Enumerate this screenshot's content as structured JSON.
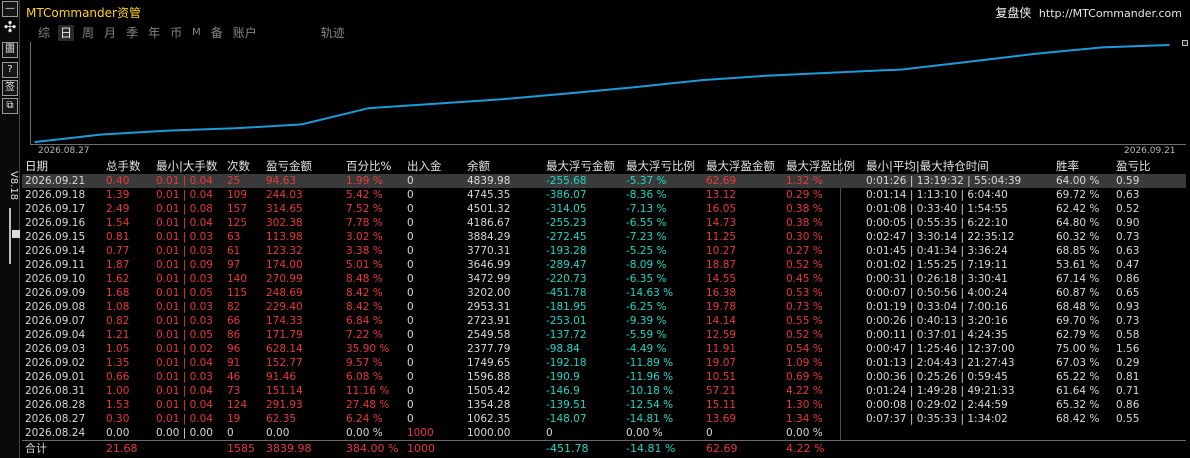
{
  "app": {
    "title": "MTCommander资管",
    "brand_name": "复盘侠",
    "brand_url": "http://MTCommander.com",
    "version": "V8.18"
  },
  "toolbar": {
    "icons": [
      "minus-icon",
      "move-icon",
      "doc-icon",
      "help-icon",
      "checkin-icon",
      "restore-icon"
    ],
    "labels": [
      "—",
      "✣",
      "圕",
      "?",
      "签",
      "⧉"
    ]
  },
  "tabs": [
    {
      "label": "综",
      "active": false
    },
    {
      "label": "日",
      "active": true
    },
    {
      "label": "周",
      "active": false
    },
    {
      "label": "月",
      "active": false
    },
    {
      "label": "季",
      "active": false
    },
    {
      "label": "年",
      "active": false
    },
    {
      "label": "币",
      "active": false
    },
    {
      "label": "M",
      "active": false
    },
    {
      "label": "备",
      "active": false
    },
    {
      "label": "账户",
      "active": false
    },
    {
      "label": "轨迹",
      "active": false
    }
  ],
  "chart_data": {
    "type": "line",
    "x_start": "2026.08.27",
    "x_end": "2026.09.21",
    "line_color": "#1c9bd8",
    "values": [
      1062.35,
      1354.28,
      1505.42,
      1596.88,
      1749.65,
      2377.79,
      2549.58,
      2723.91,
      2953.31,
      3202.0,
      3472.99,
      3646.99,
      3770.31,
      3884.29,
      4186.67,
      4501.32,
      4745.35,
      4839.98
    ]
  },
  "table": {
    "headers": [
      "日期",
      "总手数",
      "最小|大手数",
      "次数",
      "盈亏金额",
      "百分比%",
      "出入金",
      "余额",
      "最大浮亏金额",
      "最大浮亏比例",
      "最大浮盈金额",
      "最大浮盈比例",
      "最小|平均|最大持仓时间",
      "胜率",
      "盈亏比"
    ],
    "rows": [
      [
        "2026.09.21",
        "0.40",
        "0.01 | 0.04",
        "25",
        "94.63",
        "1.99 %",
        "0",
        "4839.98",
        "-255.68",
        "-5.37 %",
        "62.69",
        "1.32 %",
        "0:01:26 | 13:19:32 | 55:04:39",
        "64.00 %",
        "0.59"
      ],
      [
        "2026.09.18",
        "1.39",
        "0.01 | 0.04",
        "109",
        "244.03",
        "5.42 %",
        "0",
        "4745.35",
        "-386.07",
        "-8.36 %",
        "13.12",
        "0.29 %",
        "0:01:14 | 1:13:10 | 6:04:40",
        "69.72 %",
        "0.63"
      ],
      [
        "2026.09.17",
        "2.49",
        "0.01 | 0.08",
        "157",
        "314.65",
        "7.52 %",
        "0",
        "4501.32",
        "-314.05",
        "-7.13 %",
        "16.05",
        "0.38 %",
        "0:01:08 | 0:33:40 | 1:54:55",
        "62.42 %",
        "0.52"
      ],
      [
        "2026.09.16",
        "1.54",
        "0.01 | 0.04",
        "125",
        "302.38",
        "7.78 %",
        "0",
        "4186.67",
        "-255.23",
        "-6.55 %",
        "14.73",
        "0.38 %",
        "0:00:05 | 0:55:35 | 6:22:10",
        "64.80 %",
        "0.90"
      ],
      [
        "2026.09.15",
        "0.81",
        "0.01 | 0.03",
        "63",
        "113.98",
        "3.02 %",
        "0",
        "3884.29",
        "-272.45",
        "-7.23 %",
        "11.25",
        "0.30 %",
        "0:02:47 | 3:30:14 | 22:35:12",
        "60.32 %",
        "0.73"
      ],
      [
        "2026.09.14",
        "0.77",
        "0.01 | 0.03",
        "61",
        "123.32",
        "3.38 %",
        "0",
        "3770.31",
        "-193.28",
        "-5.25 %",
        "10.27",
        "0.27 %",
        "0:01:45 | 0:41:34 | 3:36:24",
        "68.85 %",
        "0.63"
      ],
      [
        "2026.09.11",
        "1.87",
        "0.01 | 0.09",
        "97",
        "174.00",
        "5.01 %",
        "0",
        "3646.99",
        "-289.47",
        "-8.09 %",
        "18.87",
        "0.52 %",
        "0:01:02 | 1:55:25 | 7:19:11",
        "53.61 %",
        "0.47"
      ],
      [
        "2026.09.10",
        "1.62",
        "0.01 | 0.03",
        "140",
        "270.99",
        "8.48 %",
        "0",
        "3472.99",
        "-220.73",
        "-6.35 %",
        "14.55",
        "0.45 %",
        "0:00:31 | 0:26:18 | 3:30:41",
        "67.14 %",
        "0.86"
      ],
      [
        "2026.09.09",
        "1.68",
        "0.01 | 0.05",
        "115",
        "248.69",
        "8.42 %",
        "0",
        "3202.00",
        "-451.78",
        "-14.63 %",
        "16.38",
        "0.53 %",
        "0:00:07 | 0:50:56 | 4:00:24",
        "60.87 %",
        "0.65"
      ],
      [
        "2026.09.08",
        "1.08",
        "0.01 | 0.03",
        "82",
        "229.40",
        "8.42 %",
        "0",
        "2953.31",
        "-181.95",
        "-6.25 %",
        "19.78",
        "0.73 %",
        "0:01:19 | 0:33:04 | 7:00:16",
        "68.48 %",
        "0.93"
      ],
      [
        "2026.09.07",
        "0.82",
        "0.01 | 0.03",
        "66",
        "174.33",
        "6.84 %",
        "0",
        "2723.91",
        "-253.01",
        "-9.39 %",
        "14.14",
        "0.55 %",
        "0:00:26 | 0:40:13 | 3:20:16",
        "69.70 %",
        "0.73"
      ],
      [
        "2026.09.04",
        "1.21",
        "0.01 | 0.05",
        "86",
        "171.79",
        "7.22 %",
        "0",
        "2549.58",
        "-137.72",
        "-5.59 %",
        "12.59",
        "0.52 %",
        "0:00:11 | 0:37:01 | 4:24:35",
        "62.79 %",
        "0.58"
      ],
      [
        "2026.09.03",
        "1.05",
        "0.01 | 0.02",
        "96",
        "628.14",
        "35.90 %",
        "0",
        "2377.79",
        "-98.84",
        "-4.49 %",
        "11.91",
        "0.54 %",
        "0:00:47 | 1:25:46 | 12:37:00",
        "75.00 %",
        "1.56"
      ],
      [
        "2026.09.02",
        "1.35",
        "0.01 | 0.04",
        "91",
        "152.77",
        "9.57 %",
        "0",
        "1749.65",
        "-192.18",
        "-11.89 %",
        "19.07",
        "1.09 %",
        "0:01:13 | 2:04:43 | 21:27:43",
        "67.03 %",
        "0.29"
      ],
      [
        "2026.09.01",
        "0.66",
        "0.01 | 0.03",
        "46",
        "91.46",
        "6.08 %",
        "0",
        "1596.88",
        "-190.9",
        "-11.96 %",
        "10.51",
        "0.69 %",
        "0:00:36 | 0:25:26 | 0:59:45",
        "65.22 %",
        "0.81"
      ],
      [
        "2026.08.31",
        "1.00",
        "0.01 | 0.04",
        "73",
        "151.14",
        "11.16 %",
        "0",
        "1505.42",
        "-146.9",
        "-10.18 %",
        "57.21",
        "4.22 %",
        "0:01:24 | 1:49:28 | 49:21:33",
        "61.64 %",
        "0.71"
      ],
      [
        "2026.08.28",
        "1.53",
        "0.01 | 0.04",
        "124",
        "291.93",
        "27.48 %",
        "0",
        "1354.28",
        "-139.51",
        "-12.54 %",
        "15.11",
        "1.30 %",
        "0:00:08 | 0:29:02 | 2:44:59",
        "65.32 %",
        "0.86"
      ],
      [
        "2026.08.27",
        "0.30",
        "0.01 | 0.04",
        "19",
        "62.35",
        "6.24 %",
        "0",
        "1062.35",
        "-148.07",
        "-14.81 %",
        "13.69",
        "1.34 %",
        "0:07:37 | 0:35:33 | 1:34:02",
        "68.42 %",
        "0.55"
      ],
      [
        "2026.08.24",
        "0.00",
        "0.00 | 0.00",
        "0",
        "0.00",
        "0.00 %",
        "1000",
        "1000.00",
        "0",
        "0.00 %",
        "0",
        "0.00 %",
        "",
        "",
        ""
      ]
    ],
    "total": [
      "合计",
      "21.68",
      "",
      "1585",
      "3839.98",
      "384.00 %",
      "1000",
      "",
      "-451.78",
      "-14.81 %",
      "62.69",
      "4.22 %",
      "",
      "",
      ""
    ]
  }
}
